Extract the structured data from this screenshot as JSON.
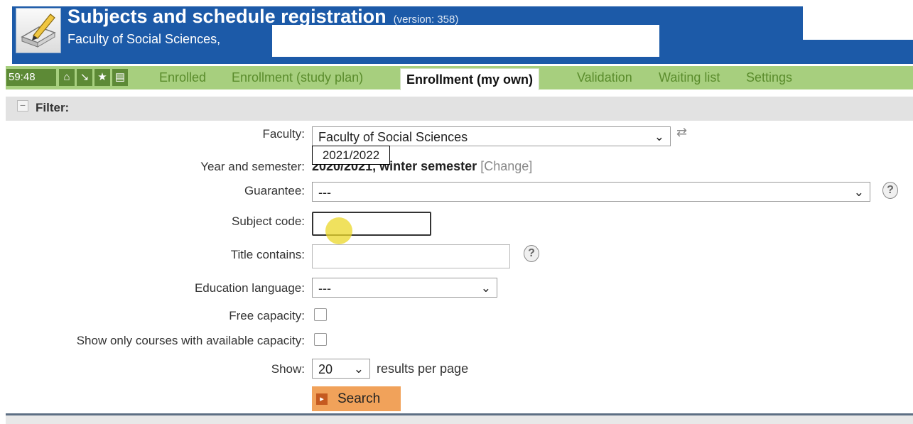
{
  "header": {
    "title": "Subjects and schedule registration",
    "version": "(version: 358)",
    "subtitle": "Faculty of Social Sciences,"
  },
  "nav": {
    "timer": "59:48",
    "icons": [
      "home-icon",
      "arrow-down-right-icon",
      "star-icon",
      "document-icon"
    ],
    "tabs": [
      {
        "label": "Enrolled",
        "active": false
      },
      {
        "label": "Enrollment (study plan)",
        "active": false
      },
      {
        "label": "Enrollment (my own)",
        "active": true
      },
      {
        "label": "Validation",
        "active": false
      },
      {
        "label": "Waiting list",
        "active": false
      },
      {
        "label": "Settings",
        "active": false
      }
    ]
  },
  "filter": {
    "toggle": "−",
    "label": "Filter:",
    "faculty": {
      "label": "Faculty:",
      "value": "Faculty of Social Sciences"
    },
    "year_semester": {
      "label": "Year and semester:",
      "overlay_year": "2021/2022",
      "year": "2020/2021",
      "semester": "winter semester",
      "change_link": "[Change]"
    },
    "guarantee": {
      "label": "Guarantee:",
      "value": "---"
    },
    "subject_code": {
      "label": "Subject code:",
      "value": ""
    },
    "title_contains": {
      "label": "Title contains:",
      "value": ""
    },
    "education_language": {
      "label": "Education language:",
      "value": "---"
    },
    "free_capacity": {
      "label": "Free capacity:",
      "checked": false
    },
    "available_only": {
      "label": "Show only courses with available capacity:",
      "checked": false
    },
    "show": {
      "label": "Show:",
      "value": "20",
      "suffix": "results per page"
    },
    "search_label": "Search"
  },
  "colors": {
    "header_blue": "#1c5aa8",
    "nav_green": "#a7cf7e",
    "tab_text_green": "#5a8c2c",
    "search_orange": "#f1a25a"
  }
}
